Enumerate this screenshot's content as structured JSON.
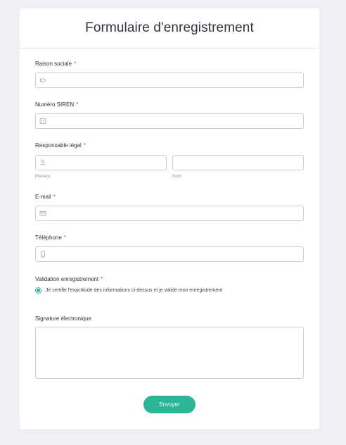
{
  "form": {
    "title": "Formulaire d'enregistrement",
    "required_marker": "*",
    "accent_color": "#2bb597",
    "required_color": "#e5485d",
    "fields": {
      "raison_sociale": {
        "label": "Raison sociale",
        "value": "",
        "icon": "tag-icon"
      },
      "siren": {
        "label": "Numéro SIREN",
        "value": "",
        "icon": "number-icon"
      },
      "responsable": {
        "label": "Responsable légal",
        "prenom": {
          "value": "",
          "sublabel": "Prénom",
          "icon": "user-icon"
        },
        "nom": {
          "value": "",
          "sublabel": "Nom"
        }
      },
      "email": {
        "label": "E-mail",
        "value": "",
        "icon": "envelope-icon"
      },
      "telephone": {
        "label": "Téléphone",
        "value": "",
        "icon": "phone-icon"
      },
      "validation": {
        "label": "Validation enregistrement",
        "option": "Je certifie l'exactitude des informations ci-dessus et je valide mon enregistrement",
        "checked": true
      },
      "signature": {
        "label": "Signature électronique"
      }
    },
    "submit_label": "Envoyer"
  }
}
